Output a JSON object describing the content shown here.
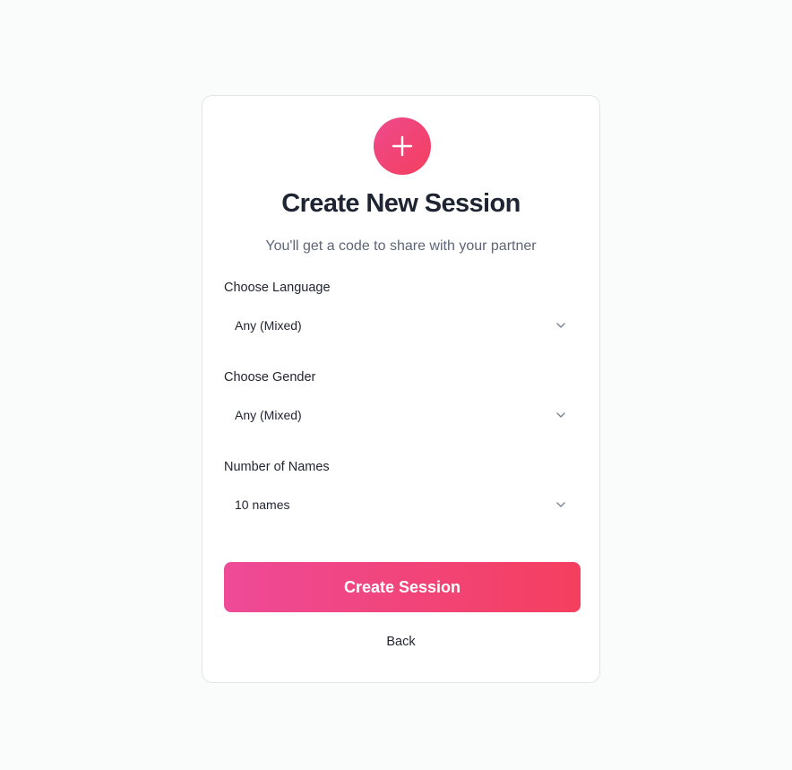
{
  "header": {
    "icon": "plus-icon",
    "title": "Create New Session",
    "subtitle": "You'll get a code to share with your partner"
  },
  "form": {
    "language": {
      "label": "Choose Language",
      "value": "Any (Mixed)"
    },
    "gender": {
      "label": "Choose Gender",
      "value": "Any (Mixed)"
    },
    "count": {
      "label": "Number of Names",
      "value": "10 names"
    }
  },
  "actions": {
    "create_label": "Create Session",
    "back_label": "Back"
  },
  "colors": {
    "accent_start": "#ee4a98",
    "accent_end": "#f43f5e",
    "page_background": "#fafbfb",
    "card_border": "#e2e4e8"
  }
}
